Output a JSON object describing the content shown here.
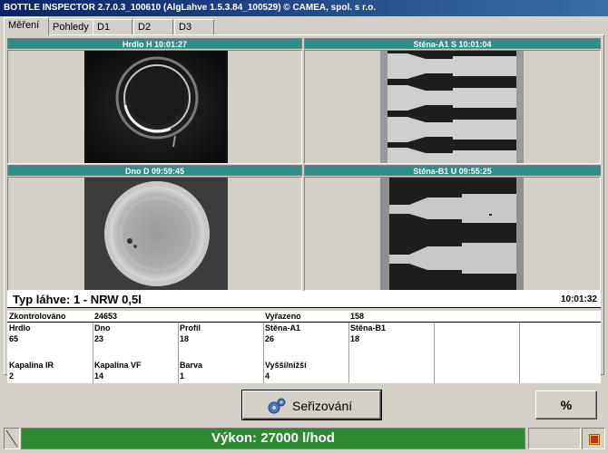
{
  "window": {
    "title": "BOTTLE INSPECTOR 2.7.0.3_100610 (AlgLahve 1.5.3.84_100529) © CAMEA, spol. s r.o."
  },
  "tabs": [
    {
      "label": "Měření",
      "active": true
    },
    {
      "label": "Pohledy",
      "active": false
    },
    {
      "label": "D1",
      "active": false
    },
    {
      "label": "D2",
      "active": false
    },
    {
      "label": "D3",
      "active": false
    }
  ],
  "cameras": {
    "hrdlo": {
      "header": "Hrdlo     H  10:01:27"
    },
    "stena_a1": {
      "header": "Stěna-A1   S  10:01:04"
    },
    "dno": {
      "header": "Dno      D  09:59:45"
    },
    "stena_b1": {
      "header": "Stěna-B1   U  09:55:25"
    }
  },
  "info": {
    "bottle_type": "Typ láhve:  1  -  NRW 0,5l",
    "time": "10:01:32"
  },
  "stats": {
    "checked_label": "Zkontrolováno",
    "checked_value": "24653",
    "rejected_label": "Vyřazeno",
    "rejected_value": "158",
    "row1_headers": [
      "Hrdlo",
      "Dno",
      "Profil",
      "Stěna-A1",
      "Stěna-B1"
    ],
    "row1_values": [
      "65",
      "23",
      "18",
      "26",
      "18"
    ],
    "row2_headers": [
      "Kapalina IR",
      "Kapalina VF",
      "Barva",
      "Vyšší/nižší"
    ],
    "row2_values": [
      "2",
      "14",
      "1",
      "4"
    ]
  },
  "buttons": {
    "calibration": "Seřizování",
    "percent": "%"
  },
  "status": {
    "performance": "Výkon: 27000 l/hod"
  },
  "colors": {
    "camera_header": "#2f8c86",
    "performance_bar": "#2c8a31",
    "title_bar": "#0a246a"
  }
}
